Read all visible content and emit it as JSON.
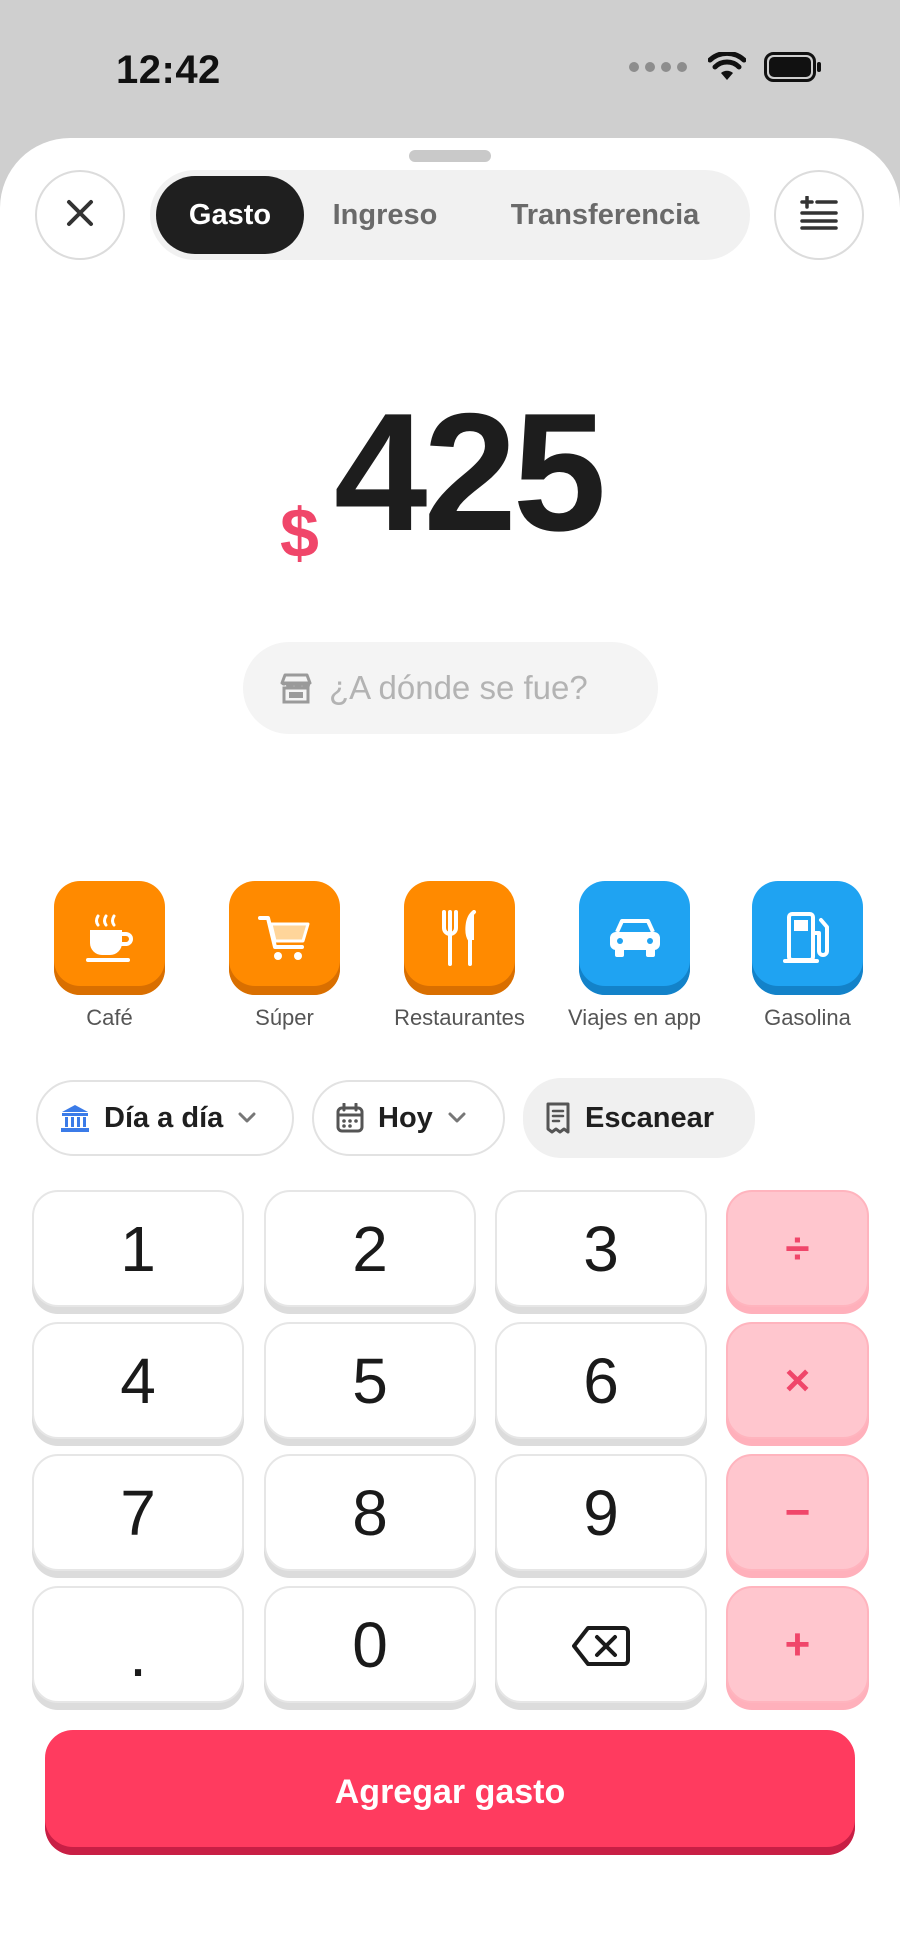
{
  "status_bar": {
    "time": "12:42"
  },
  "tabs": [
    {
      "label": "Gasto",
      "active": true
    },
    {
      "label": "Ingreso",
      "active": false
    },
    {
      "label": "Transferencia",
      "active": false
    }
  ],
  "amount": {
    "currency": "$",
    "value": "425"
  },
  "merchant": {
    "placeholder": "¿A dónde se fue?"
  },
  "categories": [
    {
      "label": "Café",
      "icon": "coffee-cup-icon",
      "color": "#ff8a00"
    },
    {
      "label": "Súper",
      "icon": "shopping-cart-icon",
      "color": "#ff8a00"
    },
    {
      "label": "Restaurantes",
      "icon": "fork-knife-icon",
      "color": "#ff8a00"
    },
    {
      "label": "Viajes en app",
      "icon": "car-icon",
      "color": "#1fa3f2"
    },
    {
      "label": "Gasolina",
      "icon": "fuel-pump-icon",
      "color": "#1fa3f2"
    }
  ],
  "chips": {
    "account": "Día a día",
    "date": "Hoy",
    "scan": "Escanear"
  },
  "keypad": {
    "digits": [
      "1",
      "2",
      "3",
      "4",
      "5",
      "6",
      "7",
      "8",
      "9",
      ".",
      "0"
    ],
    "operators": [
      "÷",
      "×",
      "−",
      "+"
    ]
  },
  "primary_action": "Agregar gasto",
  "colors": {
    "accent": "#ff3b5f",
    "currency": "#f0466a",
    "orange": "#ff8a00",
    "blue": "#1fa3f2"
  }
}
